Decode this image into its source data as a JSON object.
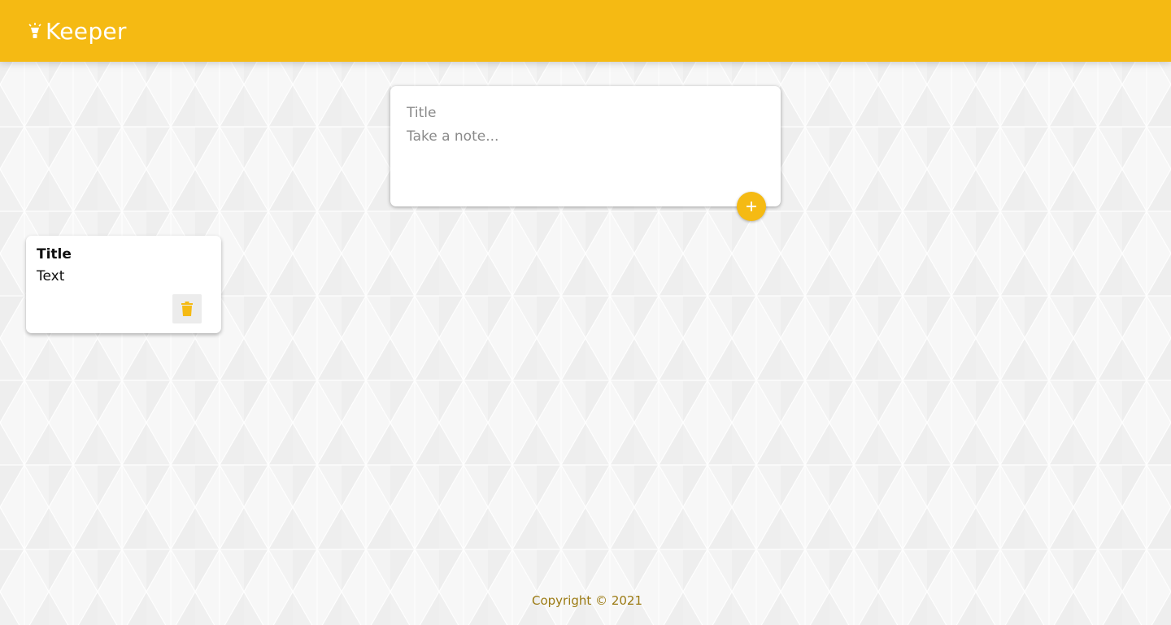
{
  "app": {
    "name": "Keeper",
    "logo_icon": "lightbulb-icon",
    "accent_color": "#f5ba13"
  },
  "compose": {
    "title_placeholder": "Title",
    "content_placeholder": "Take a note...",
    "add_icon": "plus-icon"
  },
  "notes": [
    {
      "title": "Title",
      "content": "Text",
      "delete_icon": "trash-icon"
    }
  ],
  "footer": {
    "copyright": "Copyright © 2021"
  }
}
